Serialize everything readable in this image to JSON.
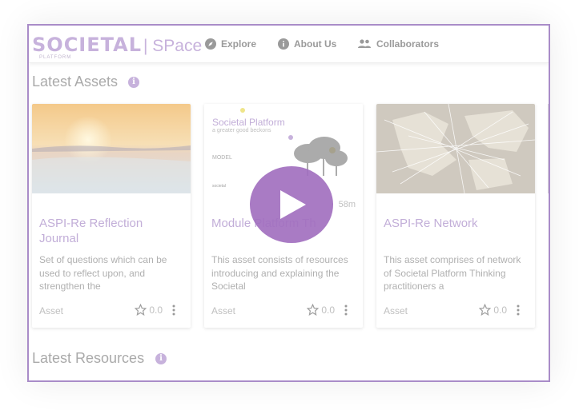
{
  "header": {
    "logo_word": "SOCIETAL",
    "logo_sub": "PLATFORM",
    "logo_space": "| SPace",
    "nav": [
      {
        "label": "Explore",
        "icon": "compass-icon"
      },
      {
        "label": "About Us",
        "icon": "info-icon"
      },
      {
        "label": "Collaborators",
        "icon": "people-icon"
      }
    ]
  },
  "sections": {
    "latest_assets": "Latest Assets",
    "latest_resources": "Latest Resources"
  },
  "cards": [
    {
      "title": "ASPI-Re Reflection Journal",
      "description": "Set of questions which can be used to reflect upon, and strengthen the",
      "type": "Asset",
      "rating": "0.0",
      "thumb": "sunset-lake"
    },
    {
      "title": "Module 1: Societal Platform Thinking",
      "title_visible": "Module Platform Th",
      "description": "This asset consists of resources introducing and explaining the Societal",
      "type": "Asset",
      "rating": "0.0",
      "thumb": "slide-preview",
      "thumb_title": "Societal Platform",
      "thumb_subtitle": "a greater good beckons",
      "thumb_label": "MODEL",
      "duration": "58m"
    },
    {
      "title": "ASPI-Re Network",
      "description": "This asset comprises of network of Societal Platform Thinking practitioners a",
      "type": "Asset",
      "rating": "0.0",
      "thumb": "world-map-network"
    }
  ],
  "colors": {
    "accent": "#a270c0",
    "border": "#a98cc8",
    "logo": "#c7b2dc"
  }
}
